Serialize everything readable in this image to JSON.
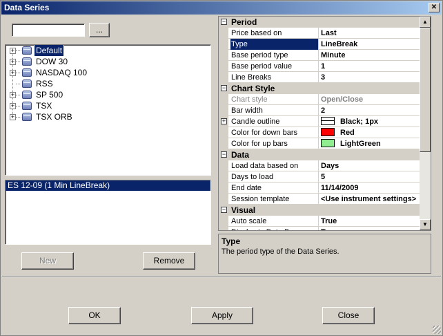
{
  "window": {
    "title": "Data Series",
    "close_glyph": "✕"
  },
  "search": {
    "value": "",
    "browse_label": "..."
  },
  "tree": {
    "items": [
      {
        "label": "Default",
        "expandable": true,
        "selected": true
      },
      {
        "label": "DOW 30",
        "expandable": true
      },
      {
        "label": "NASDAQ 100",
        "expandable": true
      },
      {
        "label": "RSS",
        "expandable": false
      },
      {
        "label": "SP 500",
        "expandable": true
      },
      {
        "label": "TSX",
        "expandable": true
      },
      {
        "label": "TSX ORB",
        "expandable": true
      }
    ]
  },
  "series_list": {
    "items": [
      {
        "label": "ES 12-09 (1 Min LineBreak)"
      }
    ]
  },
  "buttons": {
    "new": "New",
    "remove": "Remove",
    "ok": "OK",
    "apply": "Apply",
    "close": "Close"
  },
  "grid": {
    "categories": [
      {
        "name": "Period",
        "props": [
          {
            "name": "Price based on",
            "value": "Last"
          },
          {
            "name": "Type",
            "value": "LineBreak",
            "selected": true
          },
          {
            "name": "Base period type",
            "value": "Minute"
          },
          {
            "name": "Base period value",
            "value": "1"
          },
          {
            "name": "Line Breaks",
            "value": "3"
          }
        ]
      },
      {
        "name": "Chart Style",
        "props": [
          {
            "name": "Chart style",
            "value": "Open/Close",
            "readonly": true
          },
          {
            "name": "Bar width",
            "value": "2"
          },
          {
            "name": "Candle outline",
            "value": "Black; 1px",
            "swatch": "outline",
            "expandable": true
          },
          {
            "name": "Color for down bars",
            "value": "Red",
            "swatch": "#ff0000"
          },
          {
            "name": "Color for up bars",
            "value": "LightGreen",
            "swatch": "#90ee90"
          }
        ]
      },
      {
        "name": "Data",
        "props": [
          {
            "name": "Load data based on",
            "value": "Days"
          },
          {
            "name": "Days to load",
            "value": "5"
          },
          {
            "name": "End date",
            "value": "11/14/2009"
          },
          {
            "name": "Session template",
            "value": "<Use instrument settings>"
          }
        ]
      },
      {
        "name": "Visual",
        "props": [
          {
            "name": "Auto scale",
            "value": "True"
          },
          {
            "name": "Display in Data Box",
            "value": "True"
          }
        ]
      }
    ]
  },
  "help": {
    "title": "Type",
    "text": "The period type of the Data Series."
  }
}
